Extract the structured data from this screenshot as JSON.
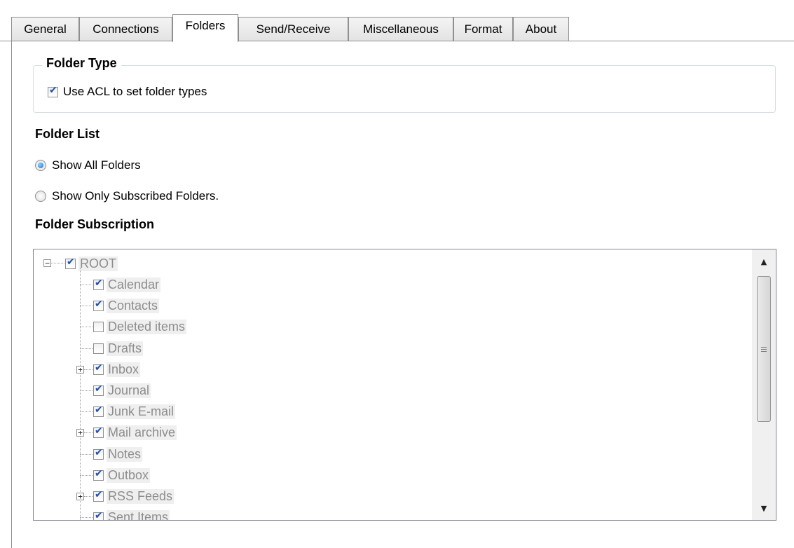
{
  "tabs": [
    {
      "label": "General"
    },
    {
      "label": "Connections"
    },
    {
      "label": "Folders",
      "active": true
    },
    {
      "label": "Send/Receive"
    },
    {
      "label": "Miscellaneous"
    },
    {
      "label": "Format"
    },
    {
      "label": "About"
    }
  ],
  "folder_type": {
    "title": "Folder Type",
    "use_acl_label": "Use ACL to set folder types",
    "use_acl_checked": true
  },
  "folder_list": {
    "title": "Folder List",
    "show_all_label": "Show All Folders",
    "show_subscribed_label": "Show Only Subscribed Folders.",
    "selected": "show_all"
  },
  "folder_subscription": {
    "title": "Folder Subscription",
    "root": {
      "label": "ROOT",
      "checked": true
    },
    "items": [
      {
        "label": "Calendar",
        "checked": true,
        "expandable": false
      },
      {
        "label": "Contacts",
        "checked": true,
        "expandable": false
      },
      {
        "label": "Deleted items",
        "checked": false,
        "expandable": false
      },
      {
        "label": "Drafts",
        "checked": false,
        "expandable": false
      },
      {
        "label": "Inbox",
        "checked": true,
        "expandable": true
      },
      {
        "label": "Journal",
        "checked": true,
        "expandable": false
      },
      {
        "label": "Junk E-mail",
        "checked": true,
        "expandable": false
      },
      {
        "label": "Mail archive",
        "checked": true,
        "expandable": true
      },
      {
        "label": "Notes",
        "checked": true,
        "expandable": false
      },
      {
        "label": "Outbox",
        "checked": true,
        "expandable": false
      },
      {
        "label": "RSS Feeds",
        "checked": true,
        "expandable": true
      },
      {
        "label": "Sent Items",
        "checked": true,
        "expandable": false
      }
    ]
  },
  "icons": {
    "scroll_up": "scroll-up-arrow-icon",
    "scroll_down": "scroll-down-arrow-icon",
    "expand": "plus-expander-icon",
    "collapse": "minus-expander-icon"
  }
}
